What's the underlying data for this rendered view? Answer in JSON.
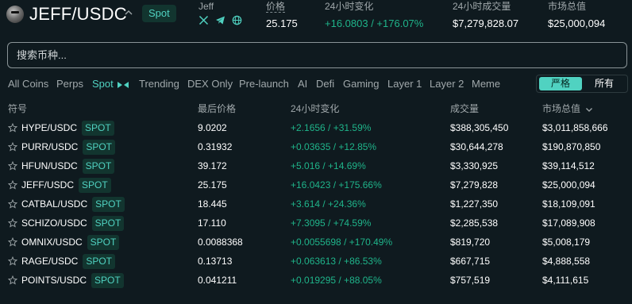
{
  "header": {
    "pair": "JEFF/USDC",
    "market_tag": "Spot",
    "token_name": "Jeff",
    "stats": [
      {
        "label": "价格",
        "value": "25.175"
      },
      {
        "label": "24小时变化",
        "value": "+16.0803 / +176.07%"
      },
      {
        "label": "24小时成交量",
        "value": "$7,279,828.07"
      },
      {
        "label": "市场总值",
        "value": "$25,000,094"
      }
    ],
    "icons": [
      "x-twitter-icon",
      "telegram-icon",
      "globe-icon"
    ]
  },
  "search": {
    "placeholder": "搜索币种..."
  },
  "filters": [
    "All Coins",
    "Perps",
    "Spot",
    "Trending",
    "DEX Only",
    "Pre-launch",
    "AI",
    "Defi",
    "Gaming",
    "Layer 1",
    "Layer 2",
    "Meme"
  ],
  "active_filter": "Spot",
  "toggle": {
    "options": [
      "严格",
      "所有"
    ],
    "selected": "严格"
  },
  "table": {
    "headers": [
      "符号",
      "最后价格",
      "24小时变化",
      "成交量",
      "市场总值"
    ],
    "badge": "SPOT",
    "rows": [
      {
        "pair": "HYPE/USDC",
        "price": "9.0202",
        "change": "+2.1656 / +31.59%",
        "volume": "$388,305,450",
        "mcap": "$3,011,858,666"
      },
      {
        "pair": "PURR/USDC",
        "price": "0.31932",
        "change": "+0.03635 / +12.85%",
        "volume": "$30,644,278",
        "mcap": "$190,870,850"
      },
      {
        "pair": "HFUN/USDC",
        "price": "39.172",
        "change": "+5.016 / +14.69%",
        "volume": "$3,330,925",
        "mcap": "$39,114,512"
      },
      {
        "pair": "JEFF/USDC",
        "price": "25.175",
        "change": "+16.0423 / +175.66%",
        "volume": "$7,279,828",
        "mcap": "$25,000,094"
      },
      {
        "pair": "CATBAL/USDC",
        "price": "18.445",
        "change": "+3.614 / +24.36%",
        "volume": "$1,227,350",
        "mcap": "$18,109,091"
      },
      {
        "pair": "SCHIZO/USDC",
        "price": "17.110",
        "change": "+7.3095 / +74.59%",
        "volume": "$2,285,538",
        "mcap": "$17,089,908"
      },
      {
        "pair": "OMNIX/USDC",
        "price": "0.0088368",
        "change": "+0.0055698 / +170.49%",
        "volume": "$819,720",
        "mcap": "$5,008,179"
      },
      {
        "pair": "RAGE/USDC",
        "price": "0.13713",
        "change": "+0.063613 / +86.53%",
        "volume": "$667,715",
        "mcap": "$4,888,558"
      },
      {
        "pair": "POINTS/USDC",
        "price": "0.041211",
        "change": "+0.019295 / +88.05%",
        "volume": "$757,519",
        "mcap": "$4,111,615"
      }
    ]
  },
  "colors": {
    "background": "#0f1a1f",
    "accent": "#50d2c1",
    "positive": "#1fb48a",
    "muted": "#a0a8ab",
    "badge_bg": "#12352f"
  }
}
